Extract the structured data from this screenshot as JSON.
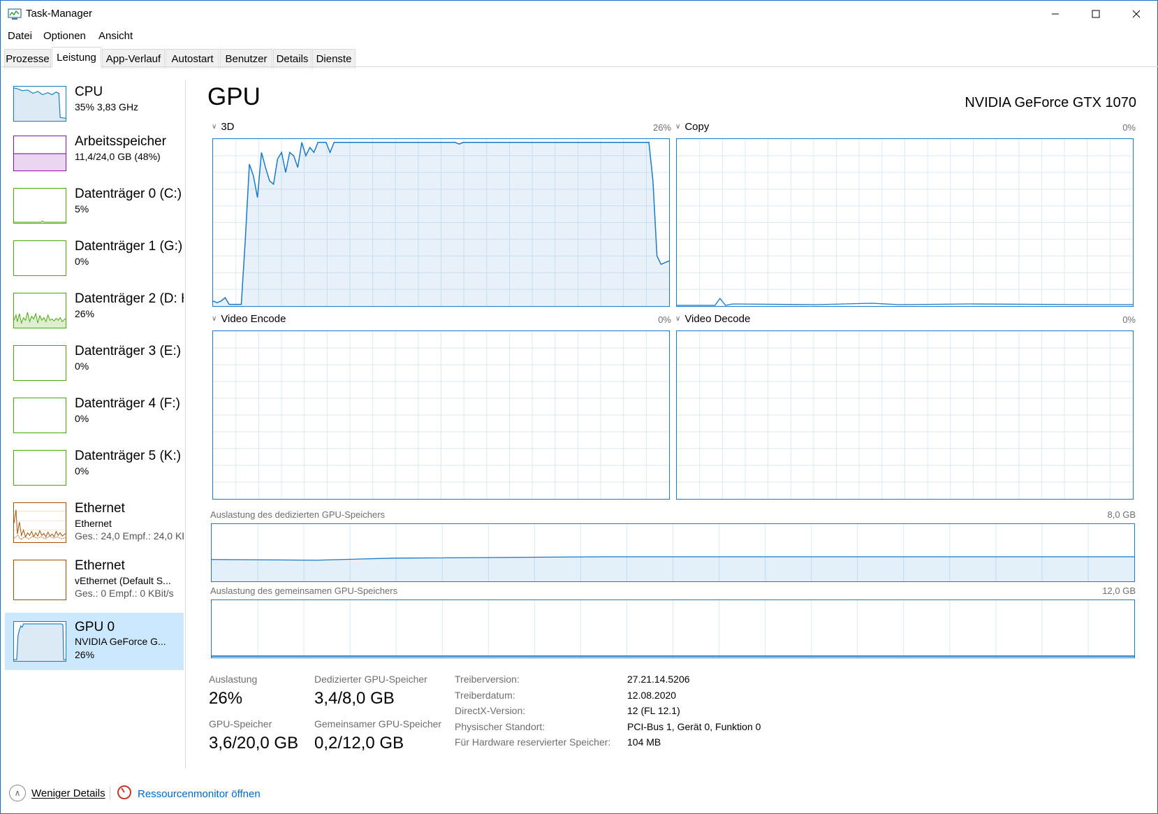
{
  "window": {
    "title": "Task-Manager"
  },
  "menu": [
    "Datei",
    "Optionen",
    "Ansicht"
  ],
  "tabs": [
    {
      "label": "Prozesse"
    },
    {
      "label": "Leistung"
    },
    {
      "label": "App-Verlauf"
    },
    {
      "label": "Autostart"
    },
    {
      "label": "Benutzer"
    },
    {
      "label": "Details"
    },
    {
      "label": "Dienste"
    }
  ],
  "active_tab": "Leistung",
  "sidebar": {
    "items": [
      {
        "title": "CPU",
        "line1": "35% 3,83 GHz",
        "line2": ""
      },
      {
        "title": "Arbeitsspeicher",
        "line1": "11,4/24,0 GB (48%)",
        "line2": ""
      },
      {
        "title": "Datenträger 0 (C:)",
        "line1": "5%",
        "line2": ""
      },
      {
        "title": "Datenträger 1 (G:)",
        "line1": "0%",
        "line2": ""
      },
      {
        "title": "Datenträger 2 (D: H",
        "line1": "26%",
        "line2": ""
      },
      {
        "title": "Datenträger 3 (E:)",
        "line1": "0%",
        "line2": ""
      },
      {
        "title": "Datenträger 4 (F:)",
        "line1": "0%",
        "line2": ""
      },
      {
        "title": "Datenträger 5 (K:)",
        "line1": "0%",
        "line2": ""
      },
      {
        "title": "Ethernet",
        "line1": "Ethernet",
        "line2": "Ges.: 24,0 Empf.: 24,0 KE"
      },
      {
        "title": "Ethernet",
        "line1": "vEthernet (Default S...",
        "line2": "Ges.: 0 Empf.: 0 KBit/s"
      },
      {
        "title": "GPU 0",
        "line1": "NVIDIA GeForce G...",
        "line2": "26%"
      }
    ]
  },
  "main": {
    "title": "GPU",
    "model": "NVIDIA GeForce GTX 1070",
    "engines": [
      {
        "name": "3D",
        "pct": "26%"
      },
      {
        "name": "Copy",
        "pct": "0%"
      },
      {
        "name": "Video Encode",
        "pct": "0%"
      },
      {
        "name": "Video Decode",
        "pct": "0%"
      }
    ],
    "dedicated_mem": {
      "label": "Auslastung des dedizierten GPU-Speichers",
      "max": "8,0 GB"
    },
    "shared_mem": {
      "label": "Auslastung des gemeinsamen GPU-Speichers",
      "max": "12,0 GB"
    }
  },
  "stats": {
    "utilization": {
      "label": "Auslastung",
      "value": "26%"
    },
    "dedicated": {
      "label": "Dedizierter GPU-Speicher",
      "value": "3,4/8,0 GB"
    },
    "gpu_mem": {
      "label": "GPU-Speicher",
      "value": "3,6/20,0 GB"
    },
    "shared": {
      "label": "Gemeinsamer GPU-Speicher",
      "value": "0,2/12,0 GB"
    }
  },
  "info": [
    {
      "label": "Treiberversion:",
      "value": "27.21.14.5206"
    },
    {
      "label": "Treiberdatum:",
      "value": "12.08.2020"
    },
    {
      "label": "DirectX-Version:",
      "value": "12 (FL 12.1)"
    },
    {
      "label": "Physischer Standort:",
      "value": "PCI-Bus 1, Gerät 0, Funktion 0"
    },
    {
      "label": "Für Hardware reservierter Speicher:",
      "value": "104 MB"
    }
  ],
  "footer": {
    "less_details": "Weniger Details",
    "resource_monitor": "Ressourcenmonitor öffnen"
  },
  "colors": {
    "cpu": "#117dbb",
    "memory": "#8b12ae",
    "disk": "#4da60c",
    "ethernet": "#a74f01",
    "gpu": "#1979ca",
    "selected": "#cce8ff"
  },
  "chart_data": {
    "type": "line",
    "title": "3D",
    "ylim": [
      0,
      100
    ],
    "series": [
      {
        "values": [
          3,
          2,
          3,
          5,
          1,
          1,
          1,
          1,
          40,
          85,
          78,
          65,
          92,
          83,
          75,
          73,
          88,
          92,
          80,
          92,
          90,
          83,
          98,
          90,
          95,
          92,
          98,
          98,
          98,
          92,
          98,
          98,
          98,
          98,
          98,
          98,
          98,
          98,
          98,
          98,
          98,
          98,
          98,
          98,
          98,
          98,
          98,
          98,
          98,
          98,
          98,
          98,
          98,
          98,
          98,
          98,
          98,
          98,
          98,
          98,
          98,
          97,
          98,
          98,
          98,
          98,
          98,
          98,
          98,
          98,
          98,
          98,
          98,
          98,
          98,
          98,
          98,
          98,
          98,
          98,
          98,
          98,
          98,
          98,
          98,
          98,
          98,
          98,
          98,
          98,
          98,
          98,
          98,
          98,
          98,
          98,
          98,
          98,
          98,
          98,
          98,
          98,
          98,
          98,
          98,
          98,
          98,
          98,
          98,
          75,
          30,
          25,
          26,
          27
        ]
      }
    ]
  }
}
